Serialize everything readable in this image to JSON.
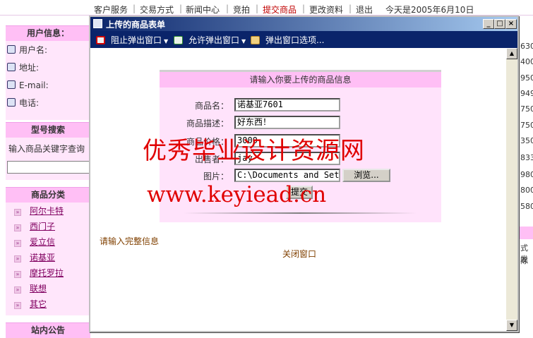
{
  "topnav": {
    "items": [
      "客户服务",
      "交易方式",
      "新闻中心",
      "竞拍",
      "提交商品",
      "更改资料",
      "退出"
    ],
    "date_text": "今天是2005年6月10日"
  },
  "left": {
    "user_info": {
      "heading": "用户信息：",
      "username_label": "用户名:",
      "address_label": "地址:",
      "email_label": "E-mail:",
      "phone_label": "电话:"
    },
    "model_search": {
      "heading": "型号搜索",
      "hint": "输入商品关键字查询"
    },
    "categories": {
      "heading": "商品分类",
      "items": [
        "阿尔卡特",
        "西门子",
        "爱立信",
        "诺基亚",
        "摩托罗拉",
        "联想",
        "其它"
      ]
    },
    "notice_heading": "站内公告"
  },
  "right_numbers": [
    "630",
    "400",
    "950",
    "949",
    "750",
    "750",
    "350",
    "833",
    "980",
    "800",
    "580"
  ],
  "right_texts": [
    "式发",
    "除"
  ],
  "popup": {
    "title": "上传的商品表单",
    "toolbar": {
      "block": "阻止弹出窗口",
      "allow": "允许弹出窗口",
      "options": "弹出窗口选项..."
    },
    "form": {
      "heading": "请输入你要上传的商品信息",
      "name_label": "商品名：",
      "name_value": "诺基亚7601",
      "desc_label": "商品描述：",
      "desc_value": "好东西！",
      "price_label": "商品价格：",
      "price_value": "3000",
      "seller_label": "出售者：",
      "seller_value": "jay",
      "image_label": "图片：",
      "image_value": "C:\\Documents and Sett",
      "browse_label": "浏览...",
      "submit_label": "提交"
    },
    "message": "请输入完整信息",
    "close_label": "关闭窗口"
  },
  "watermark": {
    "line1": "优秀毕业设计资源网",
    "line2": "www.keyiead.cn"
  },
  "colors": {
    "header_pink": "#ffbff5",
    "panel_pink": "#ffe3fb",
    "title_blue": "#0a246a",
    "watermark_red": "#e00000"
  }
}
